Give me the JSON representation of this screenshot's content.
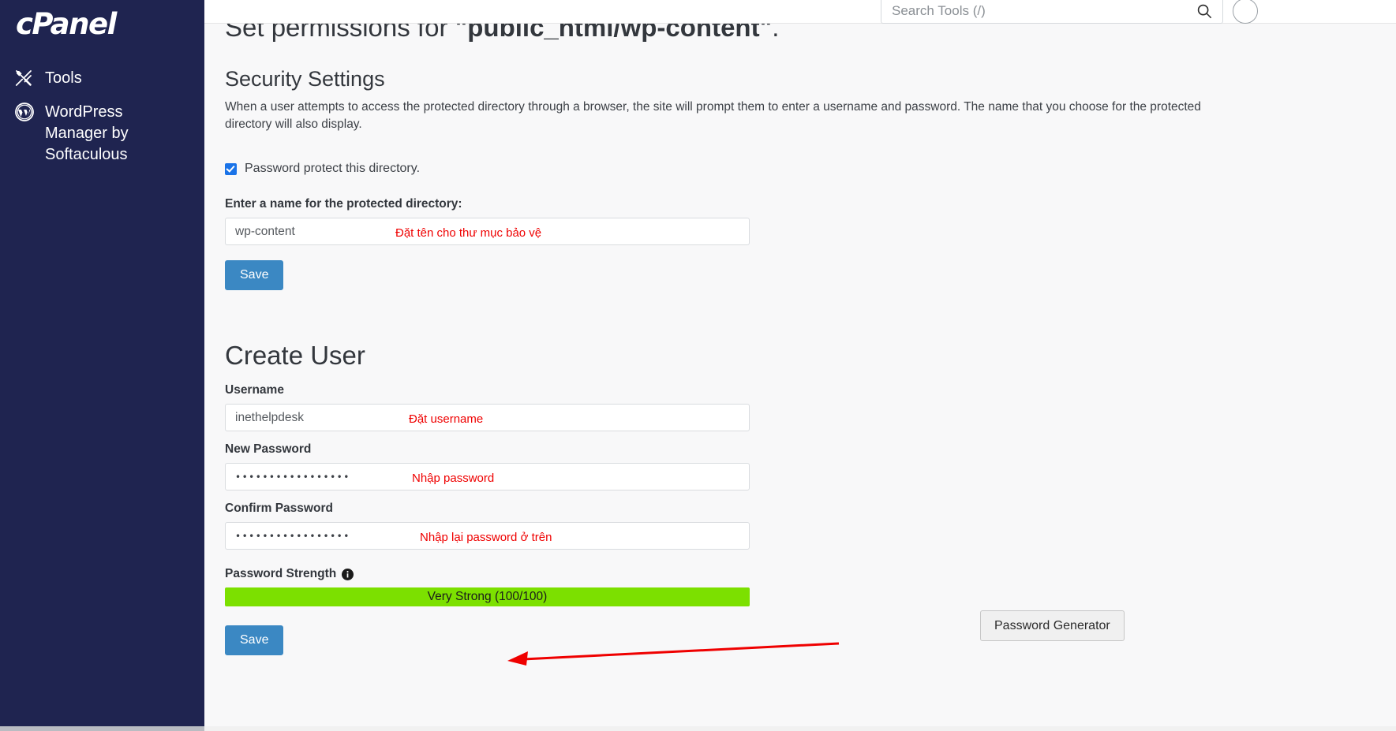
{
  "sidebar": {
    "brand": "cPanel",
    "items": [
      {
        "label": "Tools",
        "icon": "tools-icon"
      },
      {
        "label": "WordPress Manager by Softaculous",
        "icon": "wordpress-icon"
      }
    ]
  },
  "topbar": {
    "search_placeholder": "Search Tools (/)",
    "search_value": "",
    "search_icon": "search-icon",
    "avatar": "user-avatar-icon"
  },
  "page": {
    "title_prefix": "Set permissions for ",
    "title_path": "\"public_html/wp-content\"",
    "title_suffix": "."
  },
  "security": {
    "heading": "Security Settings",
    "description": "When a user attempts to access the protected directory through a browser, the site will prompt them to enter a username and password. The name that you choose for the protected\ndirectory will also display.",
    "checkbox_label": "Password protect this directory.",
    "checkbox_checked": true,
    "dir_name_label": "Enter a name for the protected directory:",
    "dir_name_value": "wp-content",
    "dir_name_note": "Đặt tên cho thư mục bảo vệ",
    "save_label": "Save"
  },
  "create_user": {
    "heading": "Create User",
    "username_label": "Username",
    "username_value": "inethelpdesk",
    "username_note": "Đặt username",
    "new_password_label": "New Password",
    "new_password_value": "•••••••••••••••••",
    "new_password_note": "Nhập password",
    "confirm_password_label": "Confirm Password",
    "confirm_password_value": "•••••••••••••••••",
    "confirm_password_note": "Nhập lại password ở trên",
    "strength_label": "Password Strength",
    "strength_info_icon": "info-icon",
    "strength_text": "Very Strong (100/100)",
    "strength_percent": 100,
    "strength_color": "#7ce000",
    "password_generator_label": "Password Generator",
    "save_label": "Save"
  },
  "colors": {
    "sidebar_bg": "#1f2450",
    "primary_button": "#3b88c3",
    "annotation_red": "#ef0000",
    "checkbox_blue": "#1a73e8",
    "strength_green": "#7ce000"
  }
}
